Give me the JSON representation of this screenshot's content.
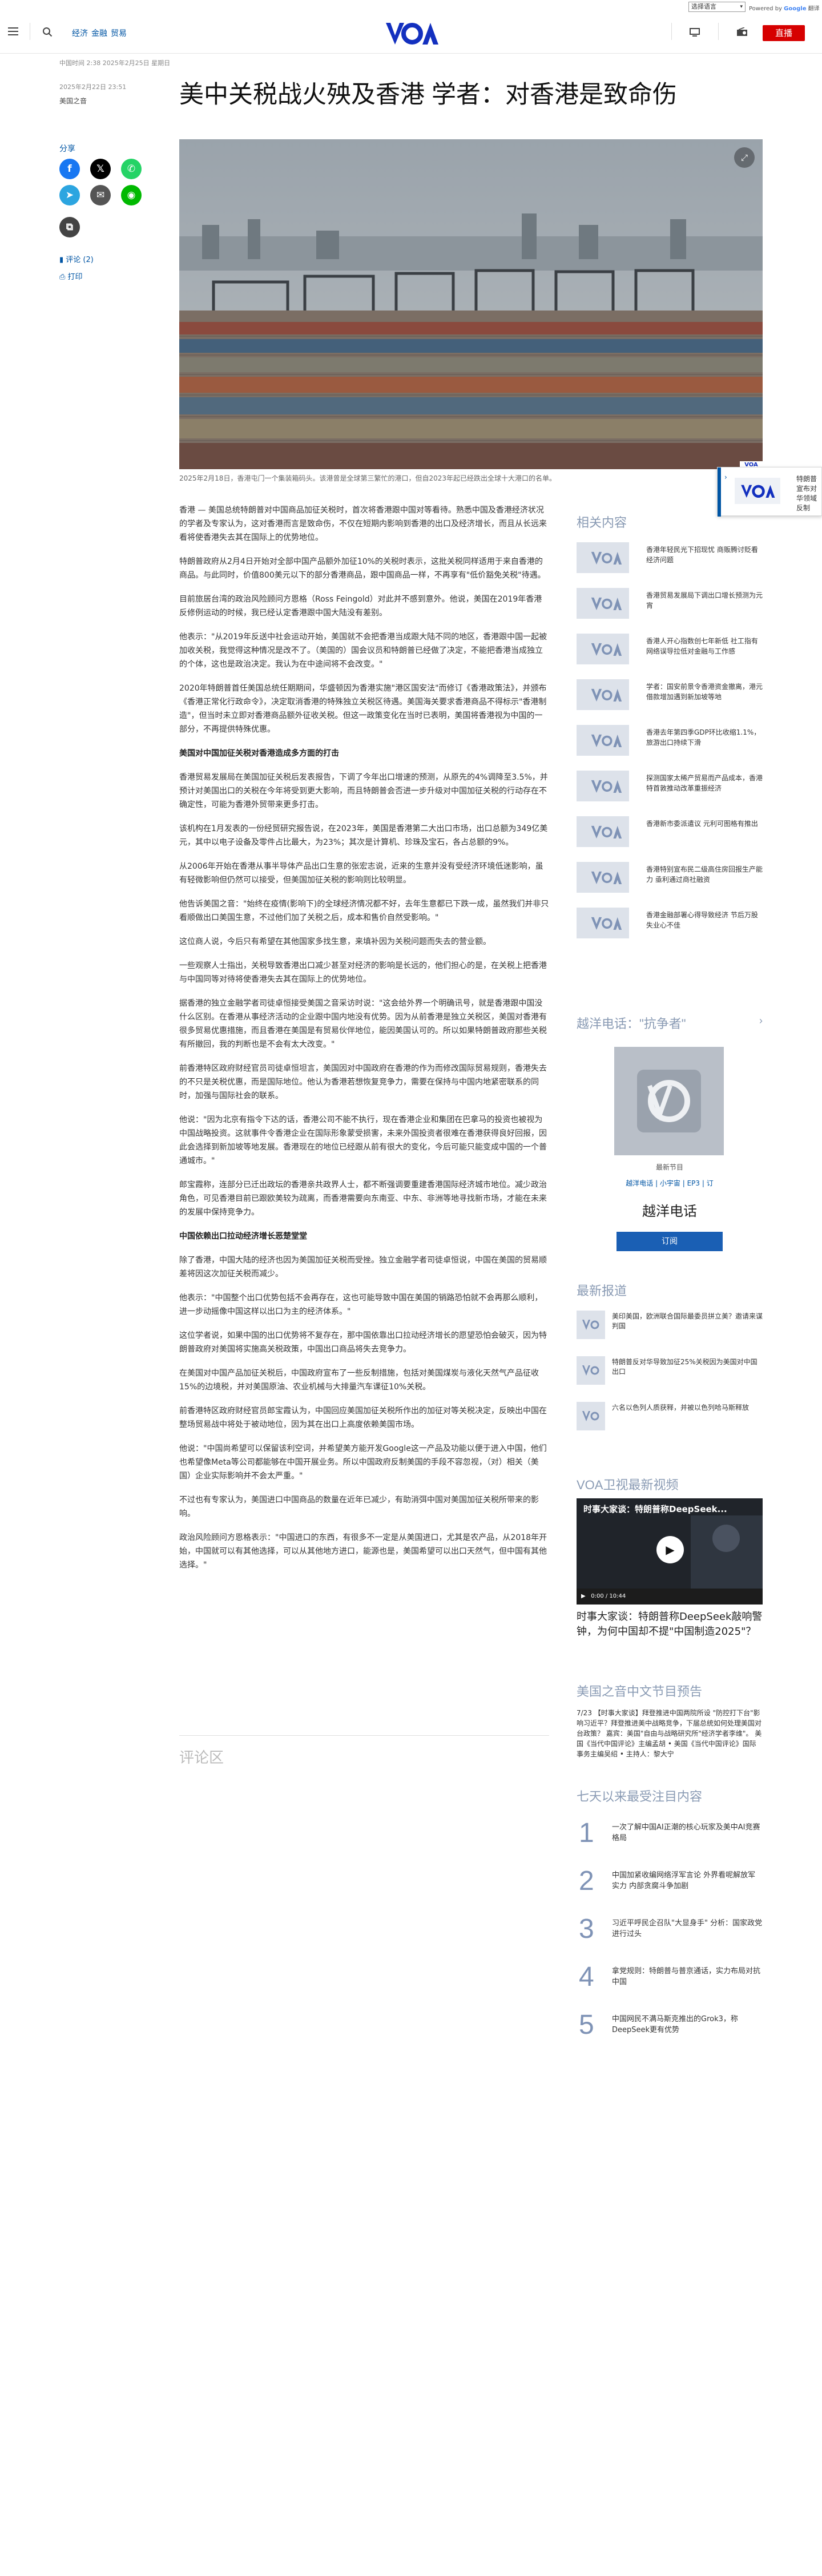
{
  "util": {
    "lang_select": "选择语言",
    "powered_by": "Powered by",
    "google": "Google",
    "translate": "翻译"
  },
  "header": {
    "nav": [
      "经济",
      "金融",
      "贸易"
    ],
    "live_label": "直播"
  },
  "article": {
    "crumb": "中国时间 2:38 2025年2月25日 星期日",
    "pub_date": "2025年2月22日 23:51",
    "section": "美国之音",
    "title": "美中关税战火殃及香港 学者：对香港是致命伤",
    "share_label": "分享",
    "comments_label": "评论 (2)",
    "print_label": "打印",
    "caption": "2025年2月18日，香港屯门一个集装箱码头。该港曾是全球第三繁忙的港口，但自2023年起已经跌出全球十大港口的名单。",
    "paragraphs": [
      "香港 — 美国总统特朗普对中国商品加征关税时，首次将香港跟中国对等看待。熟悉中国及香港经济状况的学者及专家认为，这对香港而言是致命伤，不仅在短期内影响到香港的出口及经济增长，而且从长远来看将使香港失去其在国际上的优势地位。",
      "特朗普政府从2月4日开始对全部中国产品额外加征10%的关税时表示，这批关税同样适用于来自香港的商品。与此同时，价值800美元以下的部分香港商品，跟中国商品一样，不再享有\"低价豁免关税\"待遇。",
      "目前旅居台湾的政治风险顾问方恩格（Ross Feingold）对此并不感到意外。他说，美国在2019年香港反修例运动的时候，我已经认定香港跟中国大陆没有差别。",
      "他表示：\"从2019年反送中社会运动开始，美国就不会把香港当成跟大陆不同的地区，香港跟中国一起被加收关税，我觉得这种情况是改不了。（美国的）国会议员和特朗普已经做了决定，不能把香港当成独立的个体，这也是政治决定。我认为在中途间将不会改变。\"",
      "2020年特朗普首任美国总统任期期间，华盛顿因为香港实施\"港区国安法\"而修订《香港政策法》，并颁布《香港正常化行政命令》，决定取消香港的特殊独立关税区待遇。美国海关要求香港商品不得标示\"香港制造\"，但当时未立即对香港商品额外征收关税。但这一政策变化在当时已表明，美国将香港视为中国的一部分，不再提供特殊优惠。",
      "美国对中国加征关税对香港造成多方面的打击",
      "香港贸易发展局在美国加征关税后发表报告，下调了今年出口增速的预测，从原先的4%调降至3.5%，并预计对美国出口的关税在今年将受到更大影响，而且特朗普会否进一步升级对中国加征关税的行动存在不确定性，可能为香港外贸带来更多打击。",
      "该机构在1月发表的一份经贸研究报告说，在2023年，美国是香港第二大出口市场，出口总额为349亿美元，其中以电子设备及零件占比最大，为23%；其次是计算机、珍珠及宝石，各占总额的9%。",
      "从2006年开始在香港从事半导体产品出口生意的张宏志说，近来的生意并没有受经济环境低迷影响，虽有轻微影响但仍然可以接受，但美国加征关税的影响则比较明显。",
      "他告诉美国之音：\"始终在疫情(影响下)的全球经济情况都不好，去年生意都已下跌一成，虽然我们并非只看顺做出口美国生意，不过他们加了关税之后，成本和售价自然受影响。\"",
      "这位商人说，今后只有希望在其他国家多找生意，来填补因为关税问题而失去的营业额。",
      "一些观察人士指出，关税导致香港出口减少甚至对经济的影响是长远的，他们担心的是，在关税上把香港与中国同等对待将使香港失去其在国际上的优势地位。",
      "据香港的独立金融学者司徒卓恒接受美国之音采访时说：\"这会给外界一个明确讯号，就是香港跟中国没什么区别。在香港从事经济活动的企业跟中国内地没有优势。因为从前香港是独立关税区，美国对香港有很多贸易优惠措施，而且香港在美国是有贸易伙伴地位，能因美国认可的。所以如果特朗普政府那些关税有所撤回，我的判断也是不会有太大改变。\"",
      "前香港特区政府财经官员司徒卓恒坦言，美国因对中国政府在香港的作为而修改国际贸易规则，香港失去的不只是关税优惠，而是国际地位。他认为香港若想恢复竞争力，需要在保持与中国内地紧密联系的同时，加强与国际社会的联系。",
      "他说：\"因为北京有指令下达的话，香港公司不能不执行，现在香港企业和集团在巴拿马的投资也被视为中国战略投资。这就事件令香港企业在国际形象蒙受损害，未来外国投资者很难在香港获得良好回报，因此会选择到新加坡等地发展。香港现在的地位已经跟从前有很大的变化，今后可能只能变成中国的一个普通城市。\"",
      "郎宝霞称，连部分已迁出政坛的香港亲共政界人士，都不断强调要重建香港国际经济城市地位。减少政治角色，可见香港目前已跟欧美较为疏离，而香港需要向东南亚、中东、非洲等地寻找新市场，才能在未来的发展中保持竞争力。",
      "中国依赖出口拉动经济增长恶楚堂堂",
      "除了香港，中国大陆的经济也因为美国加征关税而受挫。独立金融学者司徒卓恒说，中国在美国的贸易顺差将因这次加征关税而减少。",
      "他表示：\"中国整个出口优势包括不会再存在，这也可能导致中国在美国的销路恐怕就不会再那么顺利，进一步动摇像中国这样以出口为主的经济体系。\"",
      "这位学者说，如果中国的出口优势将不复存在，那中国依靠出口拉动经济增长的愿望恐怕会破灭，因为特朗普政府对美国将实施高关税政策，中国出口商品将失去竞争力。",
      "在美国对中国产品加征关税后，中国政府宣布了一些反制措施，包括对美国煤炭与液化天然气产品征收15%的边境税，并对美国原油、农业机械与大排量汽车课征10%关税。",
      "前香港特区政府财经官员郎宝霞认为，中国回应美国加征关税所作出的加征对等关税决定，反映出中国在整场贸易战中将处于被动地位，因为其在出口上高度依赖美国市场。",
      "他说：\"中国尚希望可以保留该利空词，并希望美方能开发Google这一产品及功能以便于进入中国，他们也希望像Meta等公司都能够在中国开展业务。所以中国政府反制美国的手段不容忽视，（对）相关（美国）企业实际影响并不会太严重。\"",
      "不过也有专家认为，美国进口中国商品的数量在近年已减少，有助消弭中国对美国加征关税所带来的影响。",
      "政治风险顾问方恩格表示：\"中国进口的东西，有很多不一定是从美国进口，尤其是农产品，从2018年开始，中国就可以有其他选择，可以从其他地方进口，能源也是，美国希望可以出口天然气，但中国有其他选择。\""
    ],
    "comments_section_label": "评论区"
  },
  "floating_panel": {
    "text": "特朗普宣布对华领域反制"
  },
  "sidebar": {
    "related_title": "相关内容",
    "related": [
      "香港年轻民光下招现忧 商贩腾讨贬看经济问题",
      "香港贸易发展局下调出口增长预测为元宵",
      "香港人开心指数创七年新低 社工指有网络误导拉低对金融与工作感",
      "学者：国安前景令香港资金撤离，港元借款增加遇到新加坡等地",
      "香港去年第四季GDP环比收缩1.1%，旅游出口持续下滑",
      "探测国家太稀产贸易而产品成本，香港特首敦推动改革重振经济",
      "香港新市委派遣议 元利可图格有推出",
      "香港特别宣布民二级高住房回报生产能力 亟利通过商社融资",
      "香港金融部署心得导致经济 节后万股失业心不佳"
    ],
    "podcast": {
      "heading": "越洋电话：\"抗争者\"",
      "label": "最新节目",
      "links": "越洋电话 | 小宇宙 | EP3 | 订",
      "title": "越洋电话",
      "subscribe": "订阅"
    },
    "latest_title": "最新报道",
    "latest": [
      "美印美国，欧洲联合国际最委员拼立美？邀请来谋判国",
      "特朗普反对华导致加征25%关税因为美国对中国出口",
      "六名以色列人质获释，并被以色列哈马斯释放"
    ],
    "video": {
      "heading": "VOA卫视最新视频",
      "overlay_title": "时事大家谈：特朗普称DeepSeek...",
      "time": "0:00 / 10:44",
      "caption": "时事大家谈：特朗普称DeepSeek敲响警钟，为何中国却不提\"中国制造2025\"？"
    },
    "am_heading": "美国之音中文节目预告",
    "am_text": "7/23 【时事大家谈】拜登推进中国两院所设 \"防控打下台\"影响习近平？拜登推进美中战略竞争，下届总统如何处理美国对台政策？ 嘉宾：美国\"自由与战略研究所\"经济学者李维\"。 美国《当代中国评论》主编孟胡 • 美国《当代中国评论》国际事务主编吴绍 • 主持人：黎大宁",
    "most_viewed_title": "七天以来最受注目内容",
    "most_viewed": [
      "一次了解中国AI正潮的核心玩家及美中AI竞赛格局",
      "中国加紧收编网络浮军言论 外界看呢解放军实力 内部贪腐斗争加剧",
      "习近平呼民企召队\"大显身手\" 分析：国家政党进行过头",
      "拿党规则：特朗普与普京通话，实力布局对抗中国",
      "中国网民不满马斯克推出的Grok3，称DeepSeek更有优势"
    ]
  },
  "colors": {
    "live": "#d60000",
    "brand": "#1330bf",
    "link": "#0055a4",
    "sidebar_heading": "#8a9bb4",
    "facebook": "#1877f2",
    "x": "#000000",
    "whatsapp": "#25d366",
    "telegram": "#2ca5e0",
    "email": "#555555",
    "line": "#00b900",
    "copy": "#444444"
  },
  "icons": [
    "menu-icon",
    "search-icon",
    "tv-icon",
    "radio-icon",
    "facebook-icon",
    "x-icon",
    "whatsapp-icon",
    "telegram-icon",
    "email-icon",
    "line-icon",
    "copy-link-icon",
    "comment-icon",
    "print-icon",
    "expand-icon",
    "play-icon",
    "chevron-right-icon"
  ]
}
